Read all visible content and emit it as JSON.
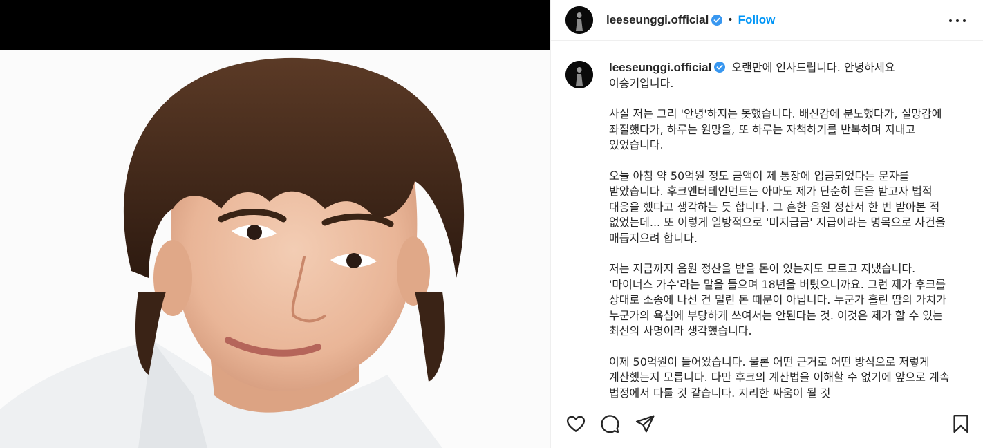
{
  "post": {
    "username": "leeseunggi.official",
    "follow_label": "Follow",
    "separator": "•",
    "caption_lead": "오랜만에 인사드립니다. 안녕하세요 이승기입니다.",
    "caption_paragraphs": [
      "사실 저는 그리 '안녕'하지는 못했습니다. 배신감에 분노했다가, 실망감에 좌절했다가, 하루는 원망을, 또 하루는 자책하기를 반복하며 지내고 있었습니다.",
      "오늘 아침 약 50억원 정도 금액이 제 통장에 입금되었다는 문자를 받았습니다. 후크엔터테인먼트는 아마도 제가 단순히 돈을 받고자 법적 대응을 했다고 생각하는 듯 합니다. 그 흔한 음원 정산서 한 번 받아본 적 없었는데... 또 이렇게 일방적으로 '미지급금' 지급이라는 명목으로 사건을 매듭지으려 합니다.",
      "저는 지금까지 음원 정산을 받을 돈이 있는지도 모르고 지냈습니다. '마이너스 가수'라는 말을 들으며 18년을 버텼으니까요. 그런 제가 후크를 상대로 소송에 나선 건 밀린 돈 때문이 아닙니다. 누군가 흘린 땀의 가치가 누군가의 욕심에 부당하게 쓰여서는 안된다는 것. 이것은 제가 할 수 있는 최선의 사명이라 생각했습니다.",
      "이제 50억원이 들어왔습니다. 물론 어떤 근거로 어떤 방식으로 저렇게 계산했는지 모릅니다. 다만 후크의 계산법을 이해할 수 없기에 앞으로 계속 법정에서 다툴 것 같습니다. 지리한 싸움이 될 것"
    ]
  },
  "icons": {
    "verified": "verified-badge-icon",
    "more": "more-options-icon",
    "like": "heart-icon",
    "comment": "comment-icon",
    "share": "share-icon",
    "save": "bookmark-icon"
  },
  "colors": {
    "link_blue": "#0095f6",
    "verified_blue": "#3897f0",
    "text": "#262626",
    "divider": "#efefef"
  }
}
